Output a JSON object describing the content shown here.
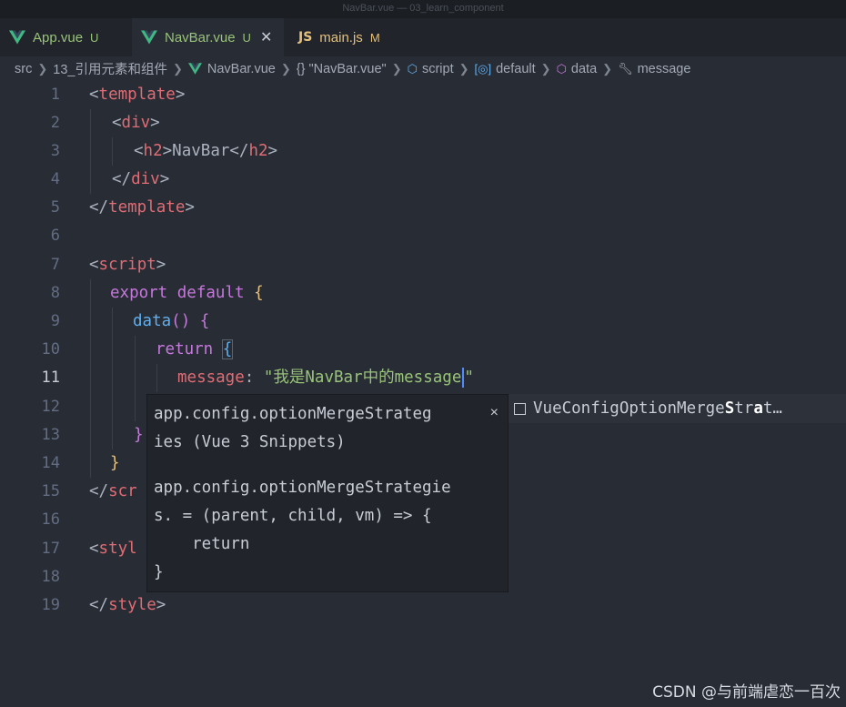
{
  "window": {
    "title": "NavBar.vue — 03_learn_component"
  },
  "tabs": [
    {
      "label": "App.vue",
      "badge": "U",
      "type": "vue"
    },
    {
      "label": "NavBar.vue",
      "badge": "U",
      "type": "vue",
      "active": true
    },
    {
      "label": "main.js",
      "badge": "M",
      "type": "js",
      "icon_text": "JS"
    }
  ],
  "breadcrumb": {
    "items": [
      "src",
      "13_引用元素和组件",
      "NavBar.vue",
      "{} \"NavBar.vue\"",
      "script",
      "default",
      "data",
      "message"
    ]
  },
  "editor": {
    "line_numbers": [
      "1",
      "2",
      "3",
      "4",
      "5",
      "6",
      "7",
      "8",
      "9",
      "10",
      "11",
      "12",
      "13",
      "14",
      "15",
      "16",
      "17",
      "18",
      "19"
    ],
    "current_line": "11",
    "code": {
      "l1": [
        "<",
        "template",
        ">"
      ],
      "l2": [
        "<",
        "div",
        ">"
      ],
      "l3": [
        "<",
        "h2",
        ">",
        "NavBar",
        "</",
        "h2",
        ">"
      ],
      "l4": [
        "</",
        "div",
        ">"
      ],
      "l5": [
        "</",
        "template",
        ">"
      ],
      "l7": [
        "<",
        "script",
        ">"
      ],
      "l8": [
        "export",
        "default",
        "{"
      ],
      "l9": [
        "data",
        "()",
        "{"
      ],
      "l10": [
        "return",
        "{"
      ],
      "l11": [
        "message",
        ":",
        "\"我是NavBar中的message",
        "\""
      ],
      "l13": "}",
      "l14": "}",
      "l15": [
        "</",
        "scr"
      ],
      "l17": [
        "<",
        "styl"
      ],
      "l19": [
        "</",
        "style",
        ">"
      ]
    }
  },
  "suggestion": {
    "doc_header": "app.config.optionMergeStrateg\nies (Vue 3 Snippets)",
    "doc_body": "app.config.optionMergeStrategie\ns. = (parent, child, vm) => {\n    return\n}",
    "close_glyph": "×",
    "list_item": {
      "before": "VueConfigOptionMerge",
      "match1": "S",
      "mid": "tr",
      "match2": "a",
      "after": "t…"
    }
  },
  "watermark": "CSDN @与前端虐恋一百次",
  "colors": {
    "bg": "#282c34",
    "tag": "#e06c75",
    "keyword": "#c678dd",
    "string": "#98c379",
    "function": "#61afef"
  }
}
